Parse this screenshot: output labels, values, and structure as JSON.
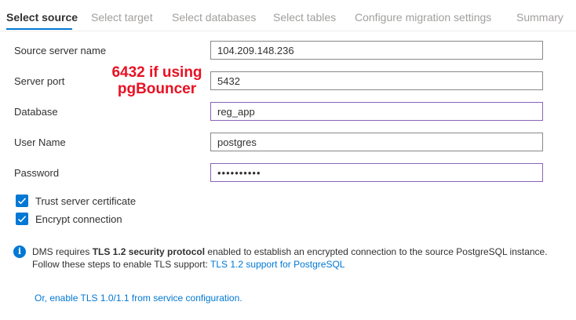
{
  "tabs": [
    {
      "label": "Select source",
      "active": true
    },
    {
      "label": "Select target",
      "active": false
    },
    {
      "label": "Select databases",
      "active": false
    },
    {
      "label": "Select tables",
      "active": false
    },
    {
      "label": "Configure migration settings",
      "active": false
    },
    {
      "label": "Summary",
      "active": false
    }
  ],
  "form": {
    "source_server_name": {
      "label": "Source server name",
      "value": "104.209.148.236"
    },
    "server_port": {
      "label": "Server port",
      "value": "5432"
    },
    "database": {
      "label": "Database",
      "value": "reg_app"
    },
    "user_name": {
      "label": "User Name",
      "value": "postgres"
    },
    "password": {
      "label": "Password",
      "value": "••••••••••"
    }
  },
  "annotation": {
    "line1": "6432 if using",
    "line2": "pgBouncer",
    "color": "#e81123"
  },
  "checkboxes": {
    "trust_cert": {
      "label": "Trust server certificate",
      "checked": true
    },
    "encrypt": {
      "label": "Encrypt connection",
      "checked": true
    }
  },
  "info": {
    "icon": "info-icon",
    "prefix": "DMS requires ",
    "bold": "TLS 1.2 security protocol",
    "suffix": " enabled to establish an encrypted connection to the source PostgreSQL instance.",
    "line2_prefix": "Follow these steps to enable TLS support: ",
    "link": "TLS 1.2 support for PostgreSQL"
  },
  "bottom_link": "Or, enable TLS 1.0/1.1 from service configuration.",
  "colors": {
    "accent": "#0078d4",
    "focus_border": "#8764b8",
    "inactive_tab": "#a19f9d"
  }
}
